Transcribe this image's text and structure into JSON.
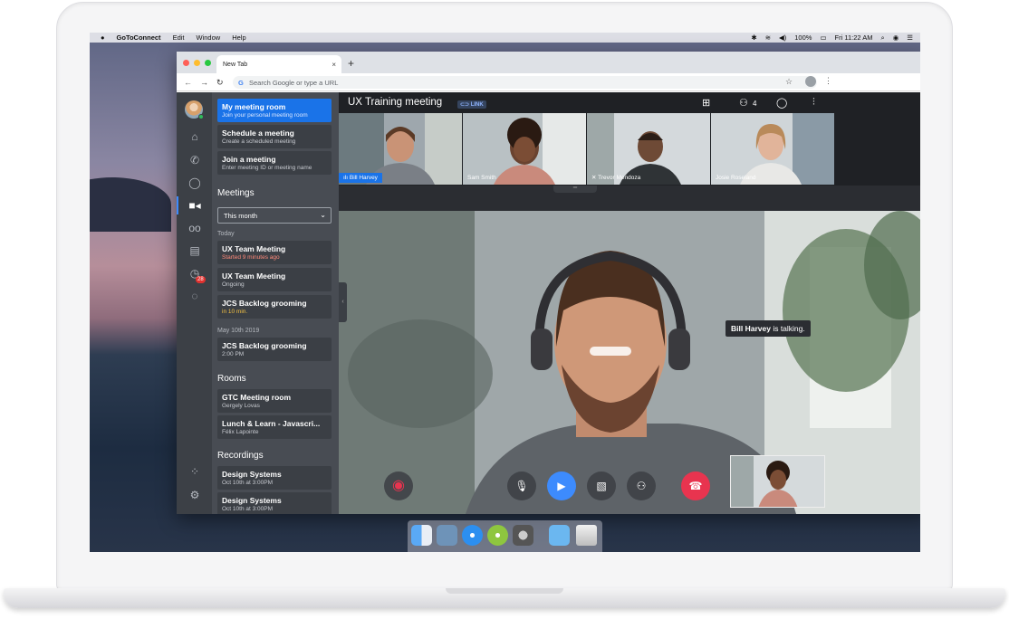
{
  "menubar": {
    "app": "GoToConnect",
    "items": [
      "Edit",
      "Window",
      "Help"
    ],
    "battery": "100%",
    "clock": "Fri 11:22 AM"
  },
  "browser": {
    "tab_title": "New Tab",
    "tab_close": "×",
    "new_tab": "+",
    "address_placeholder": "Search Google or type a URL",
    "g_letter": "G"
  },
  "sidebar": {
    "actions": [
      {
        "title": "My meeting room",
        "subtitle": "Join your personal meeting room"
      },
      {
        "title": "Schedule a meeting",
        "subtitle": "Create a scheduled meeting"
      },
      {
        "title": "Join a meeting",
        "subtitle": "Enter meeting ID or meeting name"
      }
    ],
    "meetings_heading": "Meetings",
    "filter": "This month",
    "today_label": "Today",
    "today": [
      {
        "title": "UX Team Meeting",
        "subtitle": "Started 9 minutes ago",
        "subtitle_color": "#ff8a7a"
      },
      {
        "title": "UX Team Meeting",
        "subtitle": "Ongoing",
        "subtitle_color": "#c7cad0"
      },
      {
        "title": "JCS Backlog grooming",
        "subtitle": "in 10 min.",
        "subtitle_color": "#f5c242"
      }
    ],
    "date_label": "May 10th 2019",
    "dated": [
      {
        "title": "JCS Backlog grooming",
        "subtitle": "2:00 PM"
      }
    ],
    "rooms_heading": "Rooms",
    "rooms": [
      {
        "title": "GTC Meeting room",
        "subtitle": "Gergely Lovas"
      },
      {
        "title": "Lunch & Learn - Javascri...",
        "subtitle": "Félix Lapointe"
      }
    ],
    "recordings_heading": "Recordings",
    "recordings": [
      {
        "title": "Design Systems",
        "subtitle": "Oct 10th at 3:00PM"
      },
      {
        "title": "Design Systems",
        "subtitle": "Oct 10th at 3:00PM"
      }
    ]
  },
  "rail": {
    "notification_count": "28"
  },
  "meeting": {
    "title": "UX Training meeting",
    "link_label": "⊂⊃ LINK",
    "participant_count": "4",
    "participants": [
      {
        "name": "Bill Harvey",
        "active": true
      },
      {
        "name": "Sam Smith",
        "active": false
      },
      {
        "name": "Trevor Mendoza",
        "muted": true
      },
      {
        "name": "Josie Roseland",
        "active": false
      }
    ],
    "talking_name": "Bill Harvey",
    "talking_suffix": " is talking."
  },
  "colors": {
    "accent": "#1a73e8",
    "end_call": "#e8344f",
    "record": "#e8344f"
  },
  "icons": {
    "record": "record-icon",
    "mic": "mic-off-icon",
    "camera": "video-camera-icon",
    "screen": "screen-share-off-icon",
    "add_person": "add-person-icon",
    "end": "end-call-icon"
  }
}
